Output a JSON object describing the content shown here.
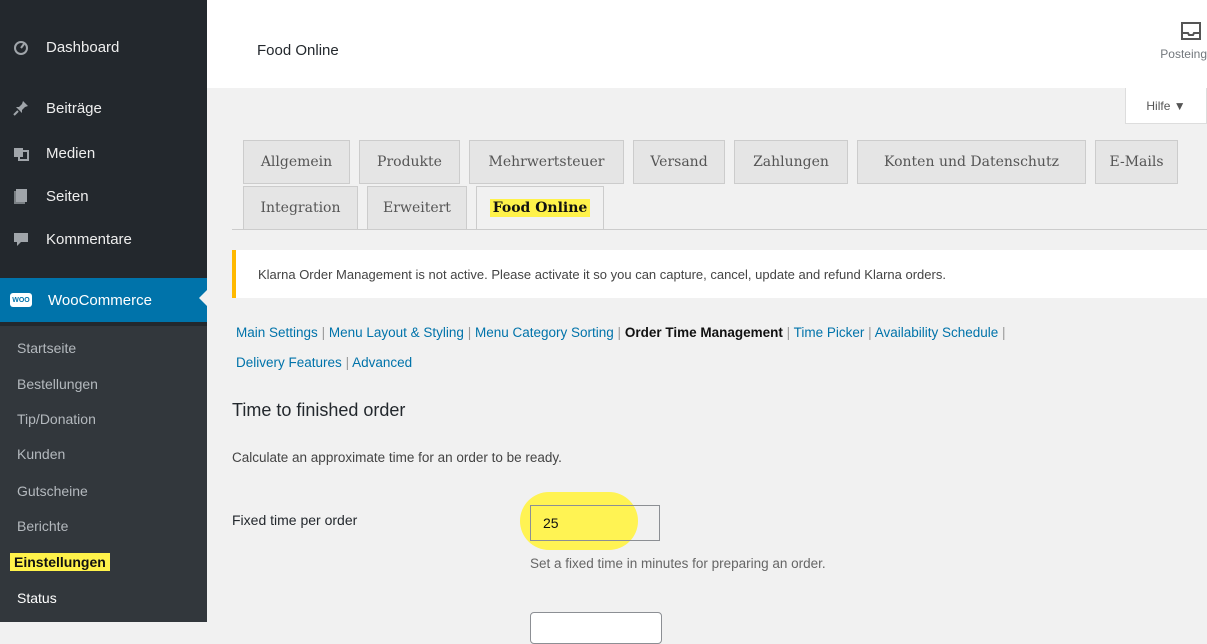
{
  "sidebar": {
    "items": [
      {
        "label": "Dashboard",
        "icon": "dashboard-icon"
      },
      {
        "label": "Beiträge",
        "icon": "pin-icon"
      },
      {
        "label": "Medien",
        "icon": "media-icon"
      },
      {
        "label": "Seiten",
        "icon": "pages-icon"
      },
      {
        "label": "Kommentare",
        "icon": "comments-icon"
      }
    ],
    "woocommerce": {
      "label": "WooCommerce",
      "logo_text": "WOO"
    },
    "submenu": [
      "Startseite",
      "Bestellungen",
      "Tip/Donation",
      "Kunden",
      "Gutscheine",
      "Berichte",
      "Einstellungen",
      "Status"
    ]
  },
  "topbar": {
    "title": "Food Online",
    "inbox_label": "Posteing"
  },
  "help": {
    "label": "Hilfe ▼"
  },
  "tabs": {
    "row1": [
      "Allgemein",
      "Produkte",
      "Mehrwertsteuer",
      "Versand",
      "Zahlungen",
      "Konten und Datenschutz",
      "E-Mails"
    ],
    "row2": [
      "Integration",
      "Erweitert",
      "Food Online"
    ],
    "active": "Food Online"
  },
  "notice": "Klarna Order Management is not active. Please activate it so you can capture, cancel, update and refund Klarna orders.",
  "sublinks": [
    "Main Settings",
    "Menu Layout & Styling",
    "Menu Category Sorting",
    "Order Time Management",
    "Time Picker",
    "Availability Schedule",
    "Delivery Features",
    "Advanced"
  ],
  "section": {
    "title": "Time to finished order",
    "description": "Calculate an approximate time for an order to be ready.",
    "field_label": "Fixed time per order",
    "field_value": "25",
    "field_description": "Set a fixed time in minutes for preparing an order."
  },
  "colors": {
    "sidebar": "#23282d",
    "active_menu": "#0073aa",
    "highlight": "#fff24a",
    "notice_border": "#ffb900",
    "link": "#0073aa"
  }
}
